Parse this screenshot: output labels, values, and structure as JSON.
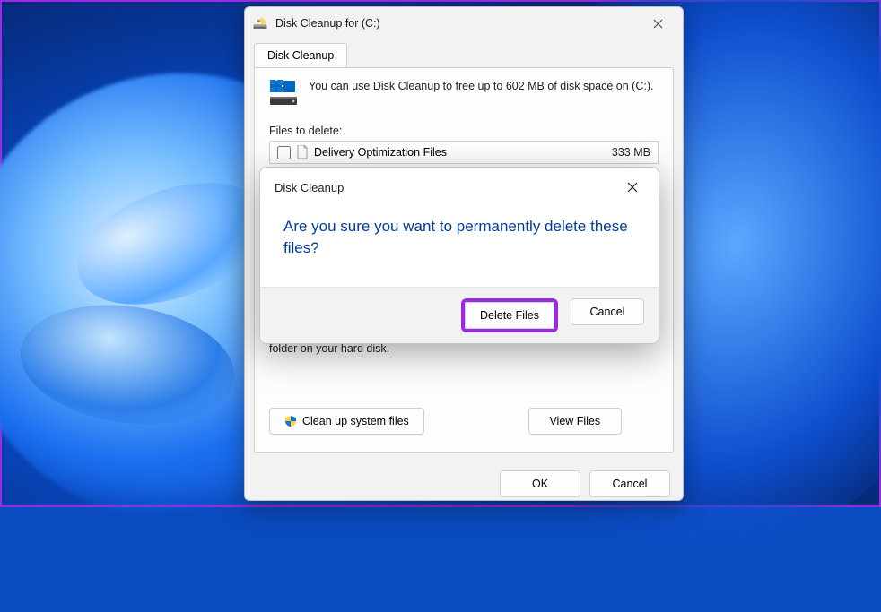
{
  "parent": {
    "title": "Disk Cleanup for  (C:)",
    "tab": "Disk Cleanup",
    "explain": "You can use Disk Cleanup to free up to 602 MB of disk space on (C:).",
    "files_label": "Files to delete:",
    "items": [
      {
        "name": "Delivery Optimization Files",
        "size": "333 MB",
        "checked": false
      }
    ],
    "description_fragment": "folder on your hard disk.",
    "cleanup_system": "Clean up system files",
    "view_files": "View Files",
    "ok": "OK",
    "cancel": "Cancel"
  },
  "confirm": {
    "title": "Disk Cleanup",
    "message": "Are you sure you want to permanently delete these files?",
    "delete": "Delete Files",
    "cancel": "Cancel"
  },
  "colors": {
    "accent": "#0067c0",
    "highlight": "#9b2ae6",
    "link": "#003d9a"
  }
}
